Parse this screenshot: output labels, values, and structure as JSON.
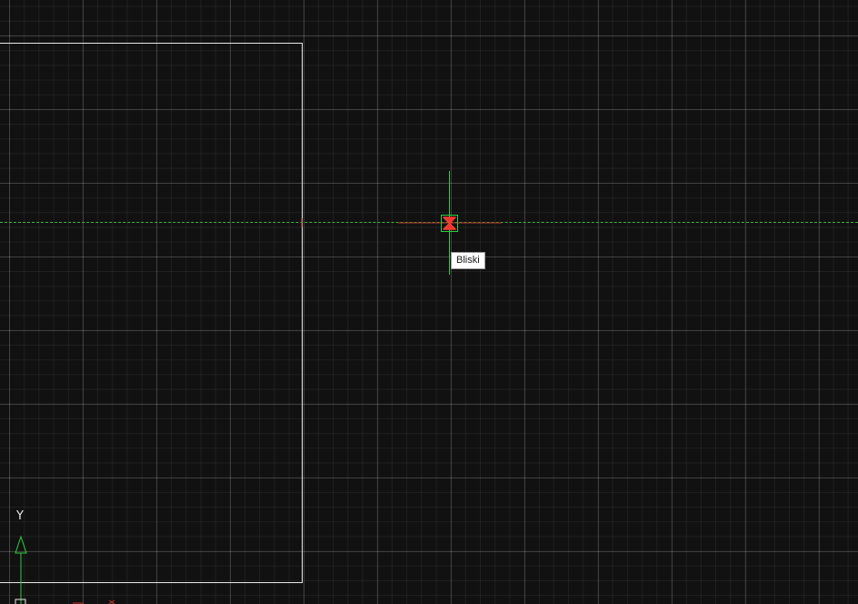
{
  "viewport": {
    "background_color": "#111111",
    "grid_color": "#2a2a2a",
    "sheet_border_color": "#e8e8e8",
    "tracking_line_color": "#3fb24a"
  },
  "cursor": {
    "crosshair_color": "#2ecc40",
    "snap_marker": "nearest-snap-icon",
    "snap_marker_color": "#e53935"
  },
  "osnap_tooltip": {
    "text": "Bliski"
  },
  "ucs_icon": {
    "y_label": "Y",
    "color": "#2ecc40"
  }
}
